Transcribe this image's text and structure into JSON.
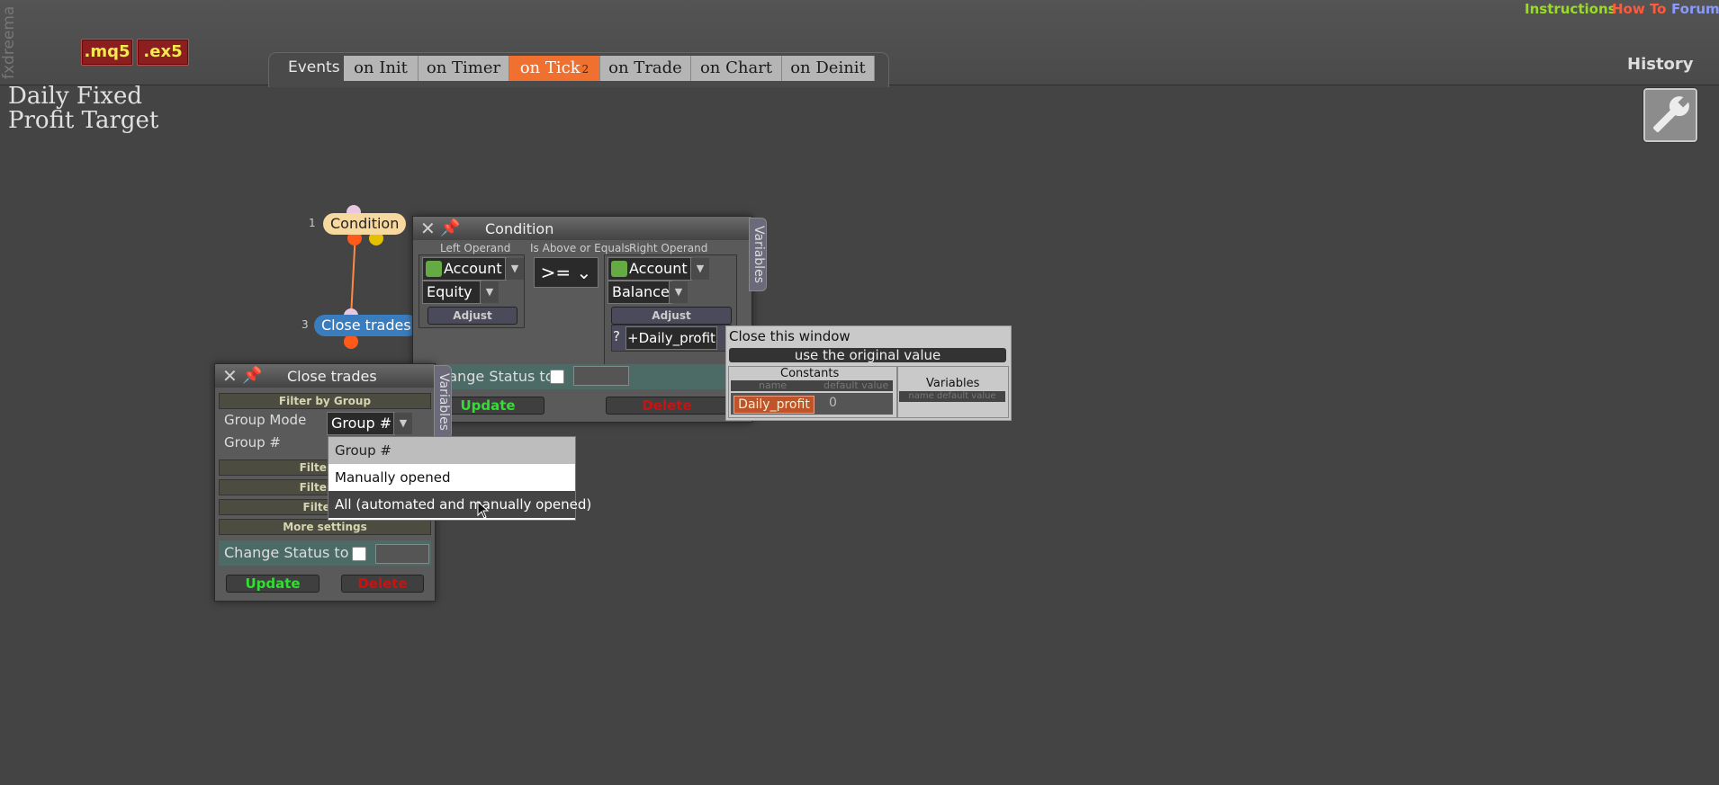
{
  "app": {
    "brand": "fxdreema",
    "file_buttons": [
      ".mq5",
      ".ex5"
    ],
    "links": [
      {
        "label": "Instructions",
        "color": "#99dd22"
      },
      {
        "label": "How To",
        "color": "#ff5a3a"
      },
      {
        "label": "Forum",
        "color": "#8899ff"
      }
    ],
    "history_label": "History",
    "project_title": "Daily Fixed Profit Target"
  },
  "events": {
    "label": "Events",
    "tabs": [
      {
        "label": "on Init"
      },
      {
        "label": "on Timer"
      },
      {
        "label": "on Tick",
        "badge": "2",
        "active": true
      },
      {
        "label": "on Trade"
      },
      {
        "label": "on Chart"
      },
      {
        "label": "on Deinit"
      }
    ]
  },
  "nodes": [
    {
      "num": "1",
      "label": "Condition"
    },
    {
      "num": "3",
      "label": "Close trades"
    }
  ],
  "condition_window": {
    "title": "Condition",
    "variables_tab": "Variables",
    "left_operand_label": "Left Operand",
    "operator_label": "Is Above or Equals",
    "right_operand_label": "Right Operand",
    "left_type": "Account",
    "left_value": "Equity",
    "operator": ">=",
    "right_type": "Account",
    "right_value": "Balance",
    "adjust_label": "Adjust",
    "right_adjust_label": "Adjust",
    "adjust_prefix": "?",
    "adjust_value": "+Daily_profit",
    "change_status_label": "Change Status to",
    "update_label": "Update",
    "delete_label": "Delete"
  },
  "close_trades_window": {
    "title": "Close trades",
    "variables_tab": "Variables",
    "filter_by_group": "Filter by Group",
    "group_mode_label": "Group Mode",
    "group_mode_value": "Group #",
    "group_num_label": "Group #",
    "filter_sections": [
      "Filter by",
      "Filter by",
      "Filter b"
    ],
    "more_settings": "More settings",
    "change_status_label": "Change Status to",
    "update_label": "Update",
    "delete_label": "Delete"
  },
  "group_mode_dropdown": {
    "options": [
      "Group #",
      "Manually opened",
      "All (automated and manually opened)"
    ],
    "highlighted_index": 2
  },
  "constants_popup": {
    "close_label": "Close this window",
    "use_original_label": "use the original value",
    "constants_header": "Constants",
    "variables_header": "Variables",
    "const_name_header": "name",
    "const_default_header": "default value",
    "var_header": "name default value",
    "constant_name": "Daily_profit",
    "constant_value": "0"
  },
  "colors": {
    "background": "#444444",
    "active_tab": "#f07030",
    "condition_node": "#f7d9a0",
    "close_node": "#3a7dbf",
    "update_green": "#33dd33",
    "delete_red": "#cc1111",
    "constant_button": "#c0532a"
  }
}
